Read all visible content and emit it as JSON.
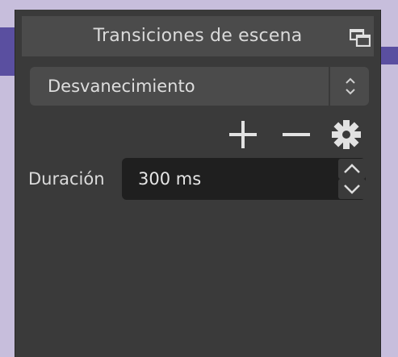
{
  "dock": {
    "title": "Transiciones de escena",
    "float_icon": "float-window-icon"
  },
  "transition_select": {
    "value": "Desvanecimiento",
    "arrow_icon": "updown-chevron-icon"
  },
  "toolbar": {
    "add_icon": "plus-icon",
    "remove_icon": "minus-icon",
    "settings_icon": "gear-icon"
  },
  "duration": {
    "label": "Duración",
    "value": "300 ms",
    "up_icon": "chevron-up-icon",
    "down_icon": "chevron-down-icon"
  },
  "colors": {
    "panel": "#3a3a3a",
    "titlebar": "#4b4b4b",
    "field": "#1f1f1f",
    "text": "#dedede",
    "background": "#c7bedc",
    "accent": "#5a4fa0"
  }
}
